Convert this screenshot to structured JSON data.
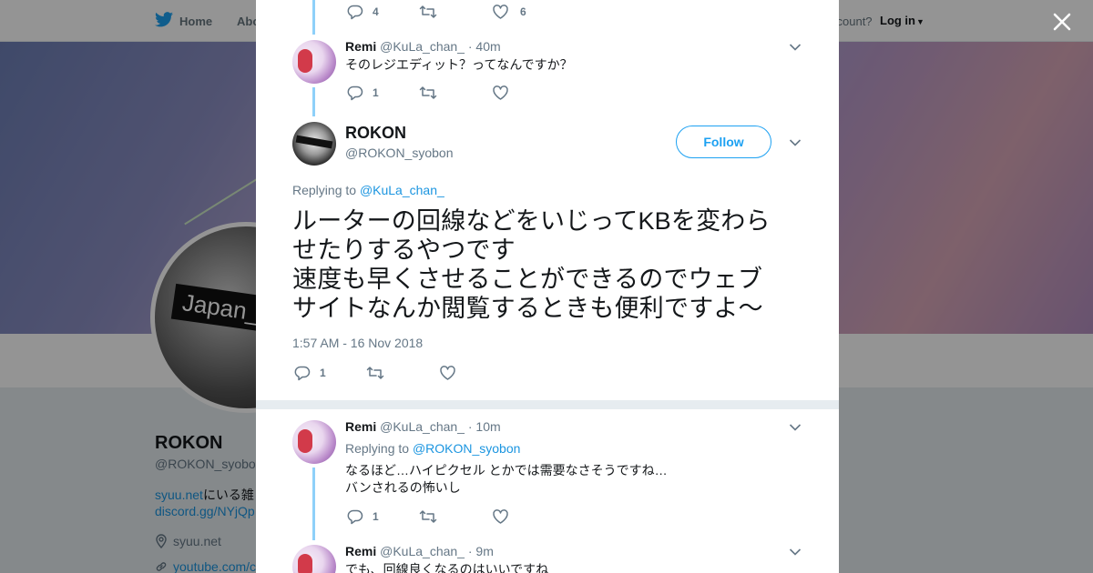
{
  "background": {
    "nav": {
      "home": "Home",
      "about": "Abo",
      "account_prompt": "ccount?",
      "login": "Log in"
    },
    "avatar_label": "Japan_",
    "profile": {
      "name": "ROKON",
      "handle": "@ROKON_syobo",
      "bio_link": "syuu.net",
      "bio_text": "にいる雑",
      "bio_line2": "discord.gg/NYjQp",
      "location": "syuu.net",
      "website": "youtube.com/c"
    }
  },
  "modal": {
    "top_tweet_actions": {
      "replies": "4",
      "retweets": "",
      "likes": "6"
    },
    "tweet1": {
      "name": "Remi",
      "handle": "@KuLa_chan_",
      "sep": "·",
      "time": "40m",
      "text": "そのレジエディット？ってなんですか？",
      "replies": "1",
      "likes": ""
    },
    "focus": {
      "name": "ROKON",
      "handle": "@ROKON_syobon",
      "follow": "Follow",
      "replying_label": "Replying to",
      "replying_handle": "@KuLa_chan_",
      "text_line1": "ルーターの回線などをいじってKBを変わら",
      "text_line2": "せたりするやつです",
      "text_line3": "速度も早くさせることができるのでウェブ",
      "text_line4": "サイトなんか閲覧するときも便利ですよ～",
      "timestamp": "1:57 AM - 16 Nov 2018",
      "replies": "1"
    },
    "reply1": {
      "name": "Remi",
      "handle": "@KuLa_chan_",
      "sep": "·",
      "time": "10m",
      "replying_label": "Replying to",
      "replying_handle": "@ROKON_syobon",
      "text_line1": "なるほど…ハイピクセル とかでは需要なさそうですね…",
      "text_line2": "バンされるの怖いし",
      "replies": "1"
    },
    "reply2": {
      "name": "Remi",
      "handle": "@KuLa_chan_",
      "sep": "·",
      "time": "9m",
      "text": "でも、回線良くなるのはいいですね"
    }
  }
}
